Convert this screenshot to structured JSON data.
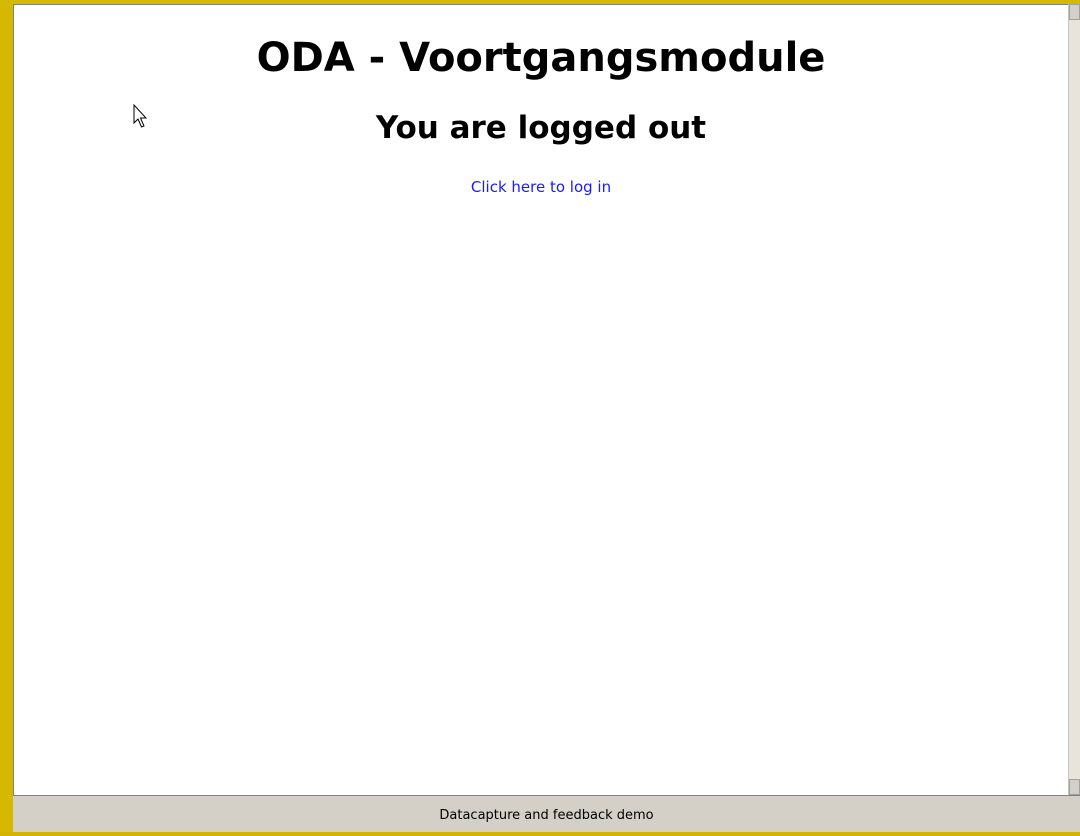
{
  "page": {
    "title": "ODA - Voortgangsmodule",
    "subtitle": "You are logged out",
    "login_link": "Click here to log in"
  },
  "statusbar": {
    "text": "Datacapture and feedback demo"
  },
  "colors": {
    "frame": "#d6b800",
    "link": "#1a1aff",
    "statusbar": "#d4d0c8"
  },
  "icons": {
    "cursor": "mouse-pointer-icon",
    "scroll_up": "scroll-up-arrow-icon",
    "scroll_down": "scroll-down-arrow-icon"
  }
}
